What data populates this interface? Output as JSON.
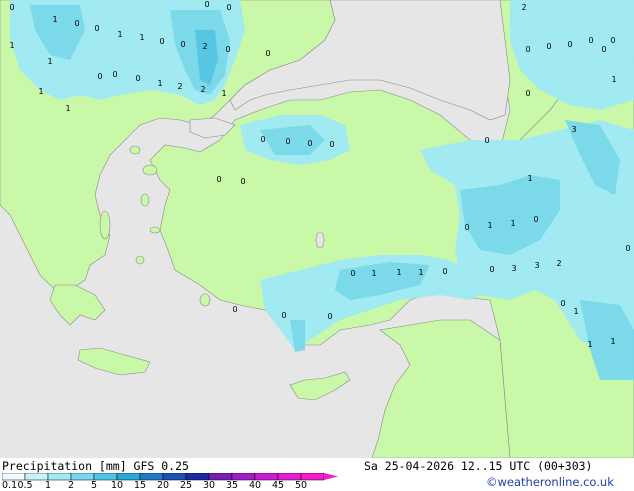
{
  "map": {
    "land_color": "#c8f8a8",
    "sea_color": "#e6e6e6",
    "precip_colors": [
      "#a0eaf5",
      "#78d8ee",
      "#50c4e6"
    ],
    "rain_labels": [
      "0",
      "1",
      "0",
      "0",
      "1",
      "1",
      "0",
      "2",
      "0",
      "0",
      "1",
      "2",
      "0",
      "0",
      "1",
      "2",
      "1",
      "0",
      "0",
      "0",
      "1",
      "0",
      "0",
      "0",
      "0",
      "2",
      "0",
      "0",
      "0",
      "0",
      "0",
      "0",
      "1",
      "0",
      "3",
      "1",
      "0",
      "0",
      "0",
      "1",
      "1",
      "0",
      "1",
      "0",
      "1",
      "1",
      "1",
      "0",
      "0",
      "3",
      "3",
      "2",
      "0",
      "0",
      "0",
      "0",
      "0",
      "0",
      "0",
      "1",
      "1",
      "1",
      "1"
    ]
  },
  "footer": {
    "title": "Precipitation [mm]  GFS 0.25",
    "datetime": "Sa 25-04-2026 12..15 UTC (00+303)",
    "credit": "©weatheronline.co.uk",
    "scale_ticks": [
      "0.1",
      "0.5",
      "1",
      "2",
      "5",
      "10",
      "15",
      "20",
      "25",
      "30",
      "35",
      "40",
      "45",
      "50"
    ],
    "scale_colors": [
      "#f0fcff",
      "#c8f2fa",
      "#a0eaf5",
      "#78d8ee",
      "#50c4e6",
      "#28a8d8",
      "#1e78c8",
      "#1e50b4",
      "#1e28a0",
      "#781eb4",
      "#a01ec8",
      "#c81ed2",
      "#e61ed2",
      "#f01ec8"
    ]
  }
}
